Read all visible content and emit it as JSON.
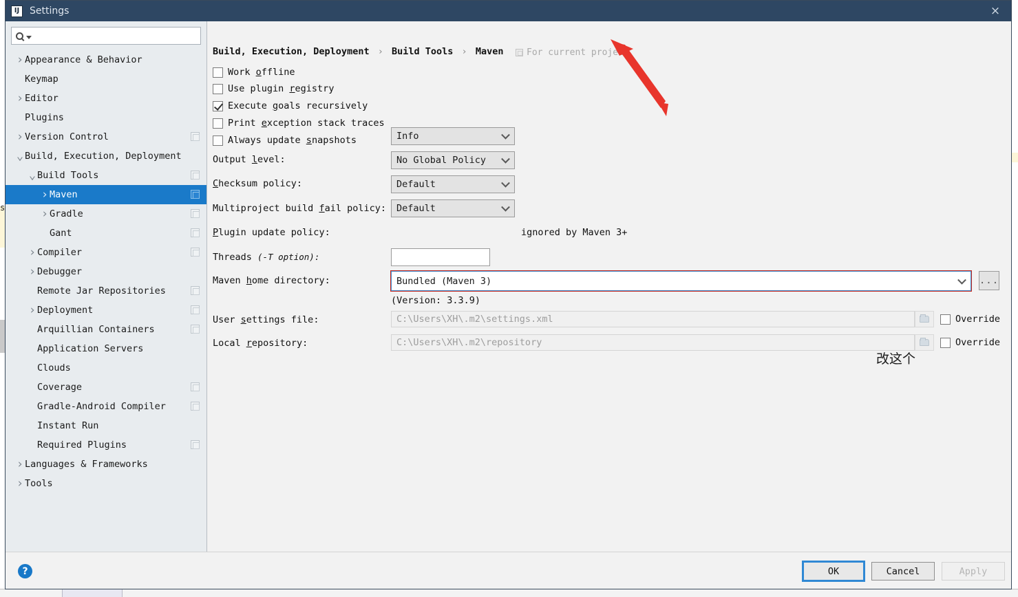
{
  "window": {
    "title": "Settings",
    "logo_text": "IJ",
    "close_icon": "×"
  },
  "sidebar": {
    "search": {
      "value": "",
      "placeholder": ""
    },
    "items": [
      {
        "label": "Appearance & Behavior",
        "indent": 0,
        "arrow": "collapsed",
        "config_icon": false,
        "selected": false
      },
      {
        "label": "Keymap",
        "indent": 0,
        "arrow": "none",
        "config_icon": false,
        "selected": false
      },
      {
        "label": "Editor",
        "indent": 0,
        "arrow": "collapsed",
        "config_icon": false,
        "selected": false
      },
      {
        "label": "Plugins",
        "indent": 0,
        "arrow": "none",
        "config_icon": false,
        "selected": false
      },
      {
        "label": "Version Control",
        "indent": 0,
        "arrow": "collapsed",
        "config_icon": true,
        "selected": false
      },
      {
        "label": "Build, Execution, Deployment",
        "indent": 0,
        "arrow": "expanded",
        "config_icon": false,
        "selected": false
      },
      {
        "label": "Build Tools",
        "indent": 1,
        "arrow": "expanded",
        "config_icon": true,
        "selected": false
      },
      {
        "label": "Maven",
        "indent": 2,
        "arrow": "collapsed",
        "config_icon": true,
        "selected": true
      },
      {
        "label": "Gradle",
        "indent": 2,
        "arrow": "collapsed",
        "config_icon": true,
        "selected": false
      },
      {
        "label": "Gant",
        "indent": 2,
        "arrow": "none",
        "config_icon": true,
        "selected": false
      },
      {
        "label": "Compiler",
        "indent": 1,
        "arrow": "collapsed",
        "config_icon": true,
        "selected": false
      },
      {
        "label": "Debugger",
        "indent": 1,
        "arrow": "collapsed",
        "config_icon": false,
        "selected": false
      },
      {
        "label": "Remote Jar Repositories",
        "indent": 1,
        "arrow": "none",
        "config_icon": true,
        "selected": false
      },
      {
        "label": "Deployment",
        "indent": 1,
        "arrow": "collapsed",
        "config_icon": true,
        "selected": false
      },
      {
        "label": "Arquillian Containers",
        "indent": 1,
        "arrow": "none",
        "config_icon": true,
        "selected": false
      },
      {
        "label": "Application Servers",
        "indent": 1,
        "arrow": "none",
        "config_icon": false,
        "selected": false
      },
      {
        "label": "Clouds",
        "indent": 1,
        "arrow": "none",
        "config_icon": false,
        "selected": false
      },
      {
        "label": "Coverage",
        "indent": 1,
        "arrow": "none",
        "config_icon": true,
        "selected": false
      },
      {
        "label": "Gradle-Android Compiler",
        "indent": 1,
        "arrow": "none",
        "config_icon": true,
        "selected": false
      },
      {
        "label": "Instant Run",
        "indent": 1,
        "arrow": "none",
        "config_icon": false,
        "selected": false
      },
      {
        "label": "Required Plugins",
        "indent": 1,
        "arrow": "none",
        "config_icon": true,
        "selected": false
      },
      {
        "label": "Languages & Frameworks",
        "indent": 0,
        "arrow": "collapsed",
        "config_icon": false,
        "selected": false
      },
      {
        "label": "Tools",
        "indent": 0,
        "arrow": "collapsed",
        "config_icon": false,
        "selected": false
      }
    ]
  },
  "main": {
    "breadcrumb": {
      "part1": "Build, Execution, Deployment",
      "part2": "Build Tools",
      "part3": "Maven",
      "separator": "›"
    },
    "scope_badge": "For current project",
    "checkboxes": [
      {
        "label_pre": "Work ",
        "mnemonic": "o",
        "label_post": "ffline",
        "checked": false
      },
      {
        "label_pre": "Use plugin ",
        "mnemonic": "r",
        "label_post": "egistry",
        "checked": false
      },
      {
        "label_pre": "Execute ",
        "mnemonic": "g",
        "label_post": "oals recursively",
        "checked": true
      },
      {
        "label_pre": "Print ",
        "mnemonic": "e",
        "label_post": "xception stack traces",
        "checked": false
      },
      {
        "label_pre": "Always update ",
        "mnemonic": "s",
        "label_post": "napshots",
        "checked": false
      }
    ],
    "fields": {
      "output_level": {
        "label_pre": "Output ",
        "mnemonic": "l",
        "label_post": "evel:",
        "value": "Info"
      },
      "checksum_policy": {
        "label_pre": "",
        "mnemonic": "C",
        "label_post": "hecksum policy:",
        "value": "No Global Policy"
      },
      "multiproject_fail_policy": {
        "label_pre": "Multiproject build ",
        "mnemonic": "f",
        "label_post": "ail policy:",
        "value": "Default"
      },
      "plugin_update_policy": {
        "label_pre": "",
        "mnemonic": "P",
        "label_post": "lugin update policy:",
        "value": "Default",
        "note": "ignored by Maven 3+"
      },
      "threads": {
        "label_pre": "Threads ",
        "label_italic": "(-T option):",
        "value": "",
        "placeholder": ""
      },
      "maven_home": {
        "label_pre": "Maven ",
        "mnemonic": "h",
        "label_post": "ome directory:",
        "value": "Bundled (Maven 3)",
        "version_note": "(Version: 3.3.9)",
        "browse_label": "..."
      },
      "user_settings": {
        "label_pre": "User ",
        "mnemonic": "s",
        "label_post": "ettings file:",
        "value": "C:\\Users\\XH\\.m2\\settings.xml",
        "override_label": "Override",
        "override_checked": false
      },
      "local_repository": {
        "label_pre": "Local ",
        "mnemonic": "r",
        "label_post": "epository:",
        "value": "C:\\Users\\XH\\.m2\\repository",
        "override_label": "Override",
        "override_checked": false
      }
    },
    "annotation": {
      "text": "改这个",
      "color": "#e8352c"
    }
  },
  "footer": {
    "help_icon": "?",
    "ok_label": "OK",
    "cancel_label": "Cancel",
    "apply_label": "Apply"
  },
  "background": {
    "left_letter": "s"
  }
}
